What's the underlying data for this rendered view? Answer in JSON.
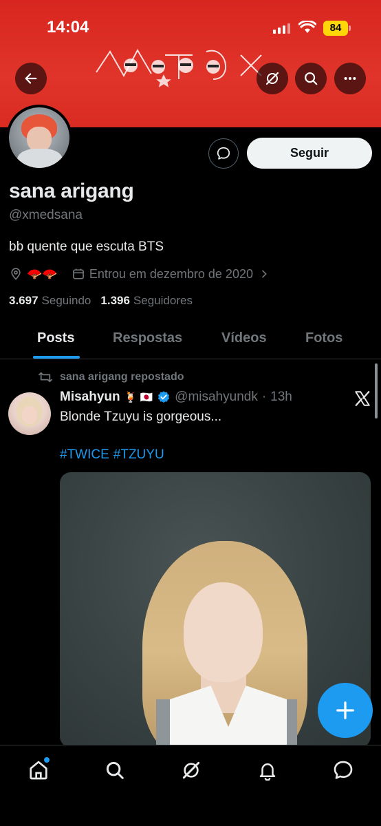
{
  "status_bar": {
    "time": "14:04",
    "battery": "84"
  },
  "profile": {
    "name": "sana arigang",
    "handle": "@xmedsana",
    "bio": "bb quente que escuta BTS",
    "location_emoji": "🪭🪭",
    "joined": "Entrou em dezembro de 2020",
    "following_count": "3.697",
    "following_label": "Seguindo",
    "followers_count": "1.396",
    "followers_label": "Seguidores",
    "follow_label": "Seguir"
  },
  "tabs": [
    {
      "label": "Posts",
      "active": true
    },
    {
      "label": "Respostas",
      "active": false
    },
    {
      "label": "Vídeos",
      "active": false
    },
    {
      "label": "Fotos",
      "active": false
    }
  ],
  "post": {
    "repost_label": "sana arigang repostado",
    "author": "Misahyun",
    "author_emoji": "🍹 🇯🇵",
    "handle": "@misahyundk",
    "dot": "·",
    "time": "13h",
    "text": "Blonde Tzuyu is gorgeous...",
    "hashtags": [
      "#TWICE",
      "#TZUYU"
    ]
  },
  "icons": {
    "back": "arrow-left-icon",
    "grok": "grok-icon",
    "search": "search-icon",
    "more": "more-horizontal-icon",
    "message": "message-bubble-icon",
    "location": "location-pin-icon",
    "calendar": "calendar-icon",
    "chevron": "chevron-right-icon",
    "repost": "repost-icon",
    "verified": "verified-badge-icon",
    "x_logo": "x-logo-icon",
    "compose": "plus-icon",
    "nav": [
      "home-icon",
      "search-icon",
      "grok-icon",
      "bell-icon",
      "message-icon"
    ]
  },
  "colors": {
    "banner": "#d8261f",
    "accent": "#1d9bf0",
    "background": "#000000",
    "muted": "#71767b"
  }
}
